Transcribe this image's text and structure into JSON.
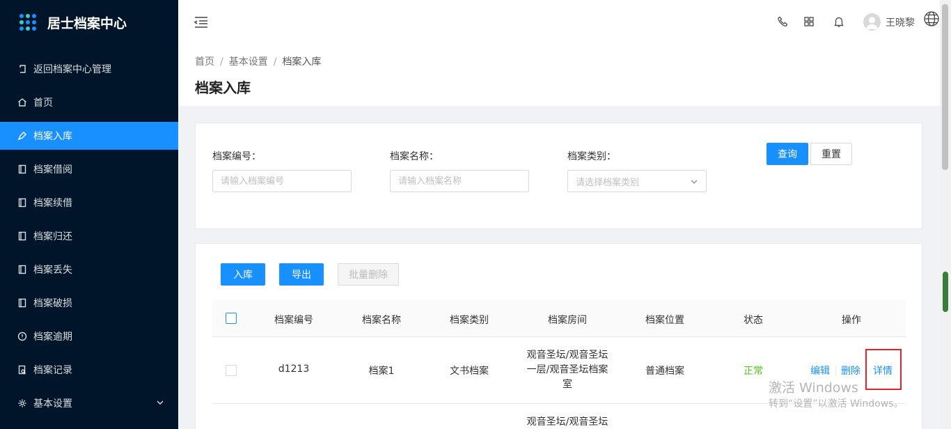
{
  "app": {
    "title": "居士档案中心"
  },
  "sidebar": {
    "items": [
      {
        "label": "返回档案中心管理",
        "icon": "return-icon"
      },
      {
        "label": "首页",
        "icon": "home-icon"
      },
      {
        "label": "档案入库",
        "icon": "pen-icon",
        "active": true
      },
      {
        "label": "档案借阅",
        "icon": "book-icon"
      },
      {
        "label": "档案续借",
        "icon": "book-icon"
      },
      {
        "label": "档案归还",
        "icon": "book-icon"
      },
      {
        "label": "档案丢失",
        "icon": "book-icon"
      },
      {
        "label": "档案破损",
        "icon": "book-icon"
      },
      {
        "label": "档案逾期",
        "icon": "alert-circle-icon"
      },
      {
        "label": "档案记录",
        "icon": "record-icon"
      },
      {
        "label": "基本设置",
        "icon": "gear-icon",
        "expandable": true
      }
    ]
  },
  "header": {
    "user_name": "王晓黎",
    "icons": [
      "phone-icon",
      "grid-icon",
      "bell-icon",
      "avatar-icon",
      "globe-icon"
    ]
  },
  "breadcrumb": {
    "items": [
      "首页",
      "基本设置",
      "档案入库"
    ],
    "separator": "/"
  },
  "page": {
    "title": "档案入库"
  },
  "search": {
    "fields": [
      {
        "label": "档案编号：",
        "placeholder": "请输入档案编号"
      },
      {
        "label": "档案名称：",
        "placeholder": "请输入档案名称"
      },
      {
        "label": "档案类别：",
        "placeholder": "请选择档案类别"
      }
    ],
    "query_label": "查询",
    "reset_label": "重置"
  },
  "toolbar": {
    "add_label": "入库",
    "export_label": "导出",
    "batch_delete_label": "批量删除"
  },
  "table": {
    "columns": [
      "档案编号",
      "档案名称",
      "档案类别",
      "档案房间",
      "档案位置",
      "状态",
      "操作"
    ],
    "rows": [
      {
        "code": "d1213",
        "name": "档案1",
        "category": "文书档案",
        "room_lines": [
          "观音圣坛/观音圣坛",
          "一层/观音圣坛档案",
          "室"
        ],
        "location": "普通档案",
        "status": "正常",
        "actions": [
          "编辑",
          "删除",
          "详情"
        ]
      },
      {
        "room_lines": [
          "观音圣坛/观音圣坛"
        ]
      }
    ]
  },
  "watermark": {
    "line1": "激活 Windows",
    "line2": "转到“设置”以激活 Windows。"
  },
  "colors": {
    "sidebar_bg": "#001529",
    "primary": "#1890ff",
    "status_normal": "#52c41a",
    "highlight": "#e8202a"
  }
}
